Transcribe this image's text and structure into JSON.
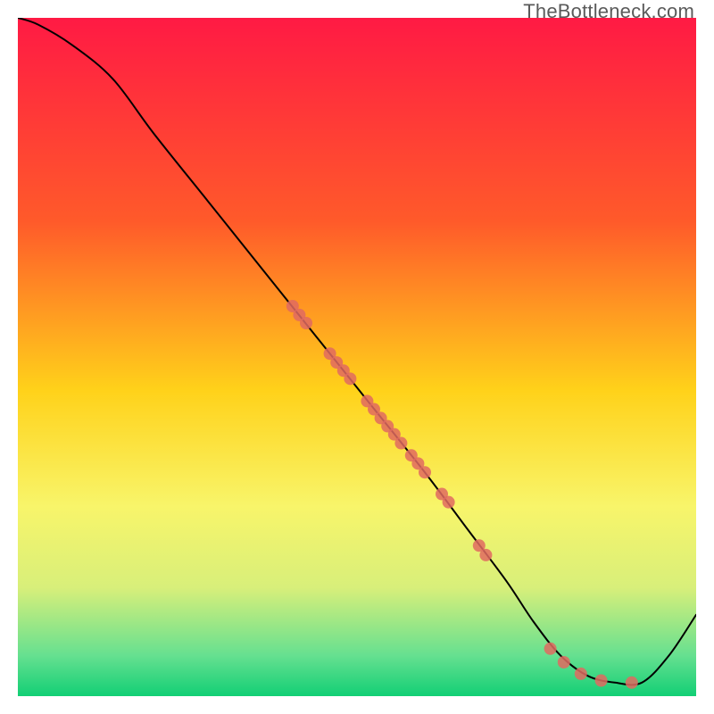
{
  "watermark": "TheBottleneck.com",
  "chart_data": {
    "type": "line",
    "title": "",
    "xlabel": "",
    "ylabel": "",
    "xlim": [
      0,
      100
    ],
    "ylim": [
      0,
      100
    ],
    "background_gradient": {
      "stops": [
        {
          "offset": 0.0,
          "color": "#ff1a44"
        },
        {
          "offset": 0.3,
          "color": "#ff5a2a"
        },
        {
          "offset": 0.55,
          "color": "#ffd21a"
        },
        {
          "offset": 0.72,
          "color": "#f8f56a"
        },
        {
          "offset": 0.84,
          "color": "#d8ef7a"
        },
        {
          "offset": 0.94,
          "color": "#66e090"
        },
        {
          "offset": 1.0,
          "color": "#12cf75"
        }
      ]
    },
    "series": [
      {
        "name": "bottleneck-curve",
        "color": "#000000",
        "width": 2,
        "x": [
          0,
          3,
          8,
          14,
          20,
          28,
          36,
          44,
          52,
          60,
          66,
          72,
          76,
          80,
          84,
          88,
          92,
          96,
          100
        ],
        "y": [
          100,
          99,
          96,
          91,
          83,
          73,
          63,
          53,
          43,
          33,
          25,
          17,
          11,
          6,
          3,
          2,
          2,
          6,
          12
        ]
      }
    ],
    "scatter": {
      "name": "sample-points",
      "color": "#e06a60",
      "radius": 7,
      "points": [
        {
          "x": 40.5,
          "y": 57.5
        },
        {
          "x": 41.5,
          "y": 56.2
        },
        {
          "x": 42.5,
          "y": 55.0
        },
        {
          "x": 46.0,
          "y": 50.5
        },
        {
          "x": 47.0,
          "y": 49.2
        },
        {
          "x": 48.0,
          "y": 48.0
        },
        {
          "x": 49.0,
          "y": 46.8
        },
        {
          "x": 51.5,
          "y": 43.5
        },
        {
          "x": 52.5,
          "y": 42.3
        },
        {
          "x": 53.5,
          "y": 41.0
        },
        {
          "x": 54.5,
          "y": 39.8
        },
        {
          "x": 55.5,
          "y": 38.6
        },
        {
          "x": 56.5,
          "y": 37.3
        },
        {
          "x": 58.0,
          "y": 35.5
        },
        {
          "x": 59.0,
          "y": 34.3
        },
        {
          "x": 60.0,
          "y": 33.0
        },
        {
          "x": 62.5,
          "y": 29.8
        },
        {
          "x": 63.5,
          "y": 28.6
        },
        {
          "x": 68.0,
          "y": 22.2
        },
        {
          "x": 69.0,
          "y": 20.8
        },
        {
          "x": 78.5,
          "y": 7.0
        },
        {
          "x": 80.5,
          "y": 5.0
        },
        {
          "x": 83.0,
          "y": 3.3
        },
        {
          "x": 86.0,
          "y": 2.3
        },
        {
          "x": 90.5,
          "y": 2.0
        }
      ]
    }
  }
}
